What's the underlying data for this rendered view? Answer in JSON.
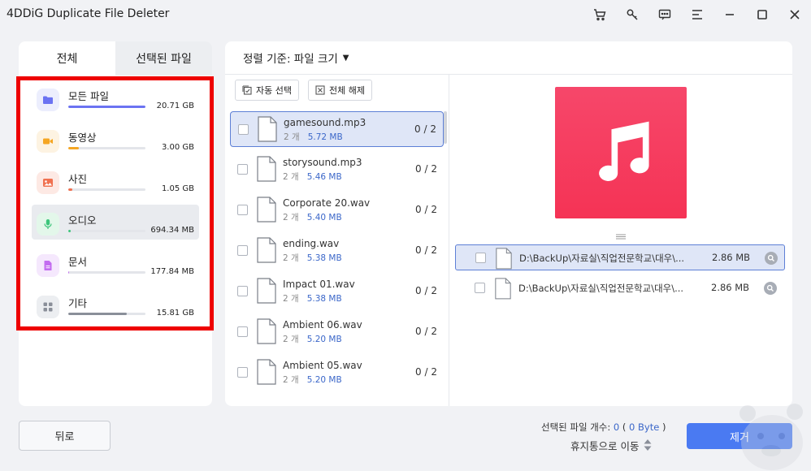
{
  "app": {
    "title": "4DDiG Duplicate File Deleter"
  },
  "titlebar_icons": [
    "cart-icon",
    "key-icon",
    "feedback-icon",
    "menu-icon",
    "minimize-icon",
    "maximize-icon",
    "close-icon"
  ],
  "tabs": [
    {
      "label": "전체",
      "active": true
    },
    {
      "label": "선택된 파일",
      "active": false
    }
  ],
  "categories": [
    {
      "name": "모든 파일",
      "size": "20.71 GB",
      "icon": "folder-icon",
      "icon_color": "#6b73f2",
      "icon_bg": "#eceefd",
      "bar_color": "#6b73f2",
      "fill": 1.0,
      "active": false
    },
    {
      "name": "동영상",
      "size": "3.00 GB",
      "icon": "video-icon",
      "icon_color": "#f5a623",
      "icon_bg": "#fdf3e2",
      "bar_color": "#f5a623",
      "fill": 0.14,
      "active": false
    },
    {
      "name": "사진",
      "size": "1.05 GB",
      "icon": "image-icon",
      "icon_color": "#f07150",
      "icon_bg": "#fde9e4",
      "bar_color": "#f07150",
      "fill": 0.05,
      "active": false
    },
    {
      "name": "오디오",
      "size": "694.34 MB",
      "icon": "microphone-icon",
      "icon_color": "#3cc57a",
      "icon_bg": "#e3f7ea",
      "bar_color": "#3cc57a",
      "fill": 0.03,
      "active": true
    },
    {
      "name": "문서",
      "size": "177.84 MB",
      "icon": "document-icon",
      "icon_color": "#c36cf0",
      "icon_bg": "#f5e8fd",
      "bar_color": "#c36cf0",
      "fill": 0.01,
      "active": false
    },
    {
      "name": "기타",
      "size": "15.81 GB",
      "icon": "grid-icon",
      "icon_color": "#8a8f99",
      "icon_bg": "#eceef1",
      "bar_color": "#8a8f99",
      "fill": 0.76,
      "active": false
    }
  ],
  "sort": {
    "label": "정렬 기준: 파일 크기"
  },
  "toolbar": {
    "auto_select": "자동 선택",
    "deselect_all": "전체 해제"
  },
  "files": [
    {
      "name": "gamesound.mp3",
      "count": "2 개",
      "size": "5.72 MB",
      "selected_count": "0 / 2",
      "selected": true
    },
    {
      "name": "storysound.mp3",
      "count": "2 개",
      "size": "5.46 MB",
      "selected_count": "0 / 2",
      "selected": false
    },
    {
      "name": "Corporate 20.wav",
      "count": "2 개",
      "size": "5.40 MB",
      "selected_count": "0 / 2",
      "selected": false
    },
    {
      "name": "ending.wav",
      "count": "2 개",
      "size": "5.38 MB",
      "selected_count": "0 / 2",
      "selected": false
    },
    {
      "name": "Impact 01.wav",
      "count": "2 개",
      "size": "5.38 MB",
      "selected_count": "0 / 2",
      "selected": false
    },
    {
      "name": "Ambient 06.wav",
      "count": "2 개",
      "size": "5.20 MB",
      "selected_count": "0 / 2",
      "selected": false
    },
    {
      "name": "Ambient 05.wav",
      "count": "2 개",
      "size": "5.20 MB",
      "selected_count": "0 / 2",
      "selected": false
    }
  ],
  "preview": {
    "icon": "music-note-icon"
  },
  "duplicates": [
    {
      "path": "D:\\BackUp\\자료실\\직업전문학교\\대우\\...",
      "size": "2.86 MB",
      "selected": true
    },
    {
      "path": "D:\\BackUp\\자료실\\직업전문학교\\대우\\...",
      "size": "2.86 MB",
      "selected": false
    }
  ],
  "footer": {
    "back_label": "뒤로",
    "selected_prefix": "선택된 파일 개수: ",
    "selected_count": "0",
    "selected_mid": " ( ",
    "selected_bytes": "0 Byte",
    "selected_suffix": " )",
    "move_label": "휴지통으로 이동",
    "remove_label": "제거"
  }
}
